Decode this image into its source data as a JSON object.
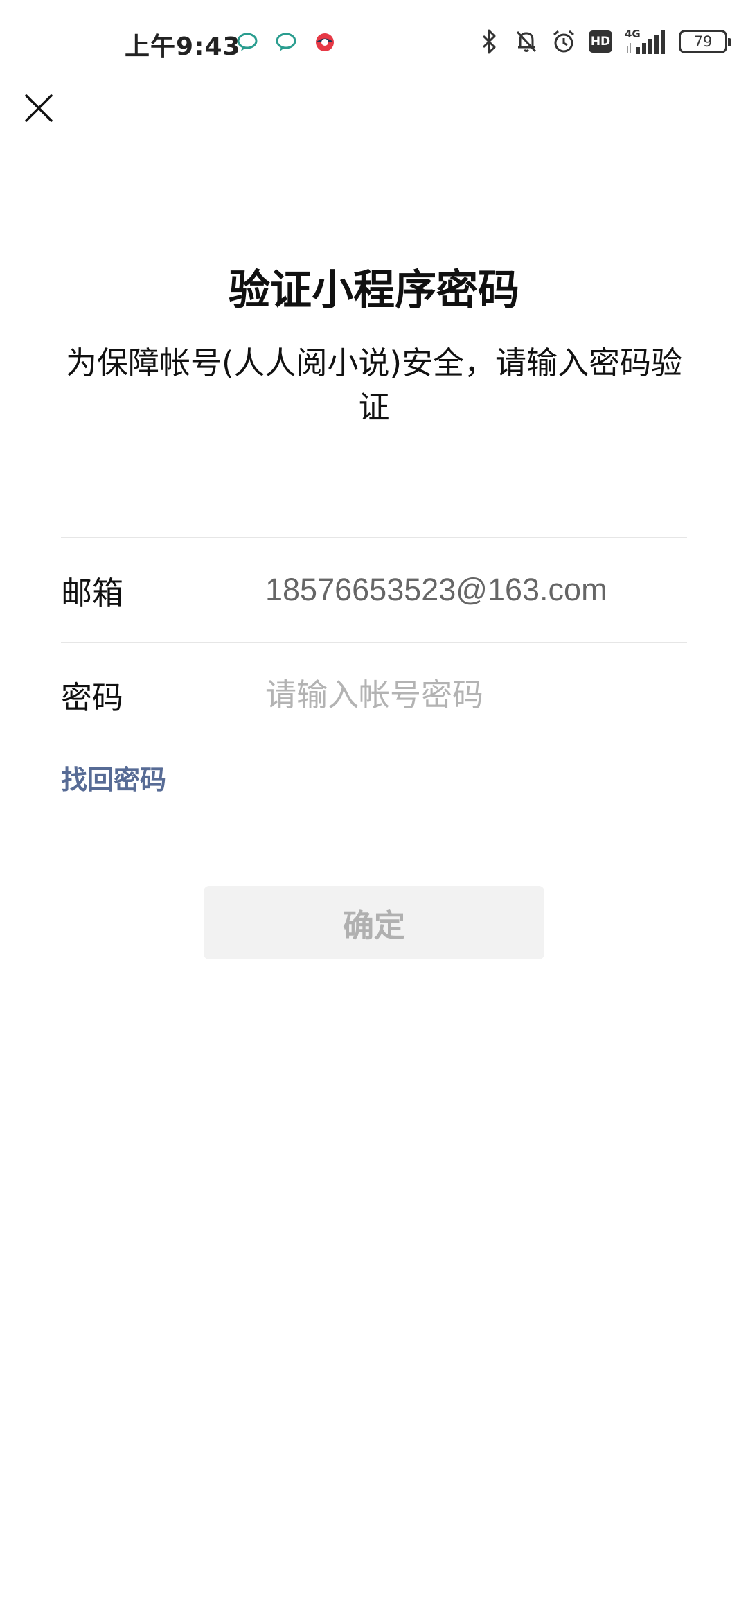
{
  "status_bar": {
    "time": "上午9:43",
    "notification_icons": [
      "chat-bubble-icon",
      "chat-bubble-icon",
      "app-globe-icon"
    ],
    "system_icons": [
      "bluetooth-icon",
      "mute-bell-icon",
      "alarm-icon",
      "hd-icon",
      "signal-icon",
      "battery-icon"
    ],
    "hd_label": "HD",
    "network_type": "4G",
    "battery_level": "79"
  },
  "header": {
    "close_icon": "close-icon"
  },
  "main": {
    "title": "验证小程序密码",
    "subtitle": "为保障帐号(人人阅小说)安全，请输入密码验证"
  },
  "form": {
    "email_label": "邮箱",
    "email_value": "18576653523@163.com",
    "password_label": "密码",
    "password_placeholder": "请输入帐号密码",
    "password_value": ""
  },
  "actions": {
    "forgot_password": "找回密码",
    "confirm": "确定"
  },
  "colors": {
    "link": "#576b95",
    "button_disabled_bg": "#f2f2f2",
    "button_disabled_text": "#b0b0b0",
    "divider": "#e6e6e6"
  }
}
